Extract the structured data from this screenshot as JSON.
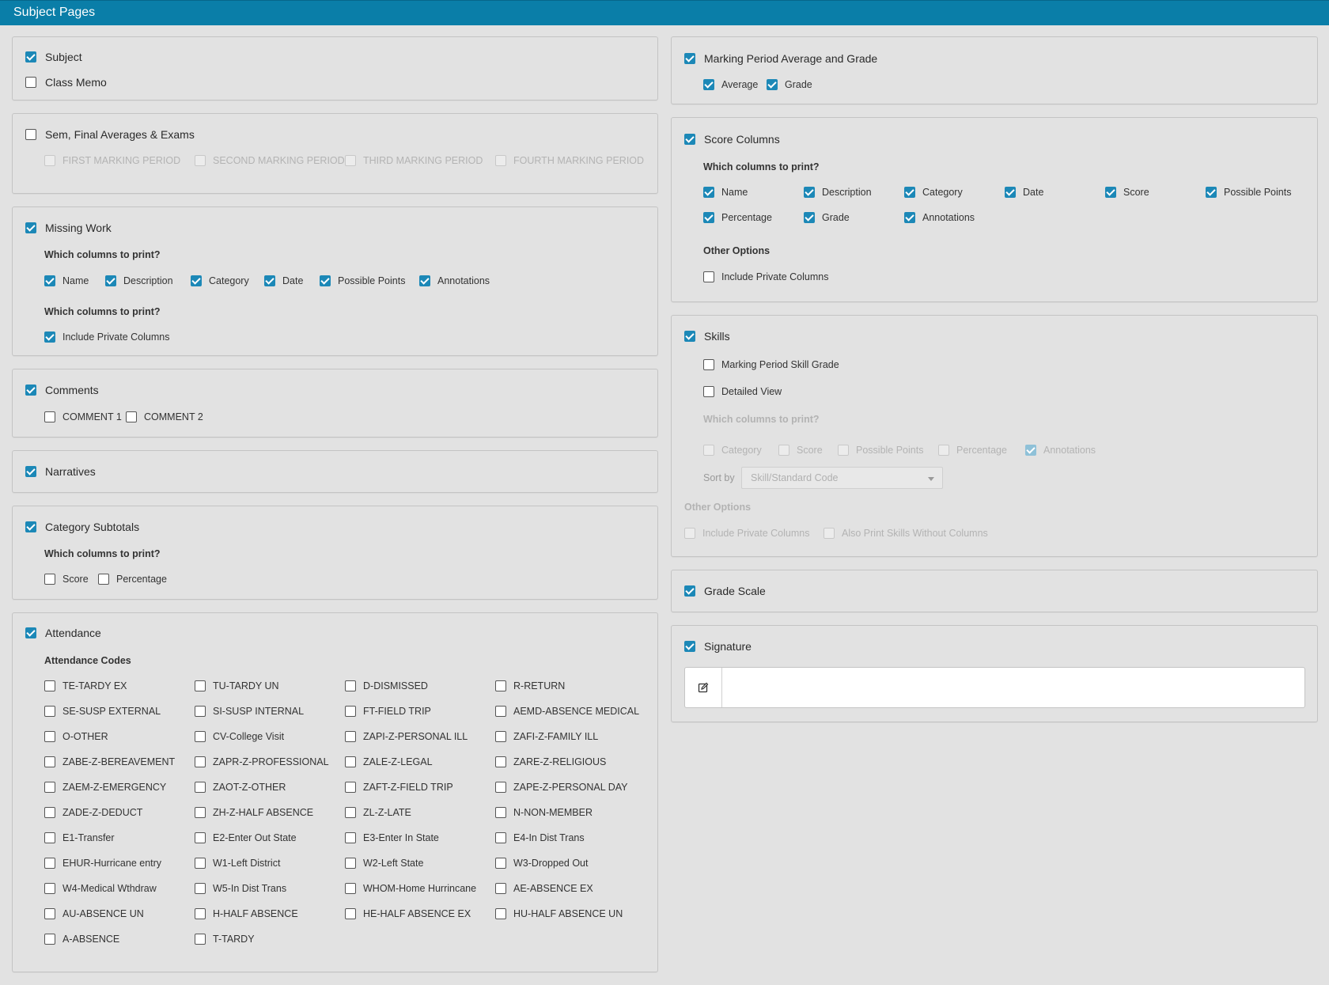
{
  "header": {
    "title": "Subject Pages"
  },
  "subject": {
    "subject_label": "Subject",
    "class_memo_label": "Class Memo"
  },
  "sem_final": {
    "label": "Sem, Final Averages & Exams",
    "periods": [
      "FIRST MARKING PERIOD",
      "SECOND MARKING PERIOD",
      "THIRD MARKING PERIOD",
      "FOURTH MARKING PERIOD"
    ]
  },
  "missing_work": {
    "label": "Missing Work",
    "columns_heading": "Which columns to print?",
    "columns": [
      "Name",
      "Description",
      "Category",
      "Date",
      "Possible Points",
      "Annotations"
    ],
    "options_heading": "Which columns to print?",
    "private_label": "Include Private Columns"
  },
  "comments": {
    "label": "Comments",
    "items": [
      "COMMENT 1",
      "COMMENT 2"
    ]
  },
  "narratives": {
    "label": "Narratives"
  },
  "category_subtotals": {
    "label": "Category Subtotals",
    "columns_heading": "Which columns to print?",
    "columns": [
      "Score",
      "Percentage"
    ]
  },
  "attendance": {
    "label": "Attendance",
    "codes_heading": "Attendance Codes",
    "codes": [
      [
        "TE-TARDY EX",
        "TU-TARDY UN",
        "D-DISMISSED",
        "R-RETURN"
      ],
      [
        "SE-SUSP EXTERNAL",
        "SI-SUSP INTERNAL",
        "FT-FIELD TRIP",
        "AEMD-ABSENCE MEDICAL"
      ],
      [
        "O-OTHER",
        "CV-College Visit",
        "ZAPI-Z-PERSONAL ILL",
        "ZAFI-Z-FAMILY ILL"
      ],
      [
        "ZABE-Z-BEREAVEMENT",
        "ZAPR-Z-PROFESSIONAL",
        "ZALE-Z-LEGAL",
        "ZARE-Z-RELIGIOUS"
      ],
      [
        "ZAEM-Z-EMERGENCY",
        "ZAOT-Z-OTHER",
        "ZAFT-Z-FIELD TRIP",
        "ZAPE-Z-PERSONAL DAY"
      ],
      [
        "ZADE-Z-DEDUCT",
        "ZH-Z-HALF ABSENCE",
        "ZL-Z-LATE",
        "N-NON-MEMBER"
      ],
      [
        "E1-Transfer",
        "E2-Enter Out State",
        "E3-Enter In State",
        "E4-In Dist Trans"
      ],
      [
        "EHUR-Hurricane entry",
        "W1-Left District",
        "W2-Left State",
        "W3-Dropped Out"
      ],
      [
        "W4-Medical Wthdraw",
        "W5-In Dist Trans",
        "WHOM-Home Hurrincane",
        "AE-ABSENCE EX"
      ],
      [
        "AU-ABSENCE UN",
        "H-HALF ABSENCE",
        "HE-HALF ABSENCE EX",
        "HU-HALF ABSENCE UN"
      ],
      [
        "A-ABSENCE",
        "T-TARDY"
      ]
    ]
  },
  "mp_avg": {
    "label": "Marking Period Average and Grade",
    "average_label": "Average",
    "grade_label": "Grade"
  },
  "score_columns": {
    "label": "Score Columns",
    "columns_heading": "Which columns to print?",
    "columns_row1": [
      "Name",
      "Description",
      "Category",
      "Date",
      "Score",
      "Possible Points"
    ],
    "columns_row2": [
      "Percentage",
      "Grade",
      "Annotations"
    ],
    "other_heading": "Other Options",
    "private_label": "Include Private Columns"
  },
  "skills": {
    "label": "Skills",
    "mp_skill_label": "Marking Period Skill Grade",
    "detailed_label": "Detailed View",
    "columns_heading": "Which columns to print?",
    "columns": [
      "Category",
      "Score",
      "Possible Points",
      "Percentage",
      "Annotations"
    ],
    "sort_label": "Sort by",
    "sort_value": "Skill/Standard Code",
    "other_heading": "Other Options",
    "private_label": "Include Private Columns",
    "also_print_label": "Also Print Skills Without Columns"
  },
  "grade_scale": {
    "label": "Grade Scale"
  },
  "signature": {
    "label": "Signature"
  },
  "colors": {
    "header": "#0a7ea8",
    "checkbox_checked": "#1c88b7",
    "background": "#e2e2e2"
  },
  "icons": {
    "edit": "edit-icon",
    "caret": "chevron-down-icon"
  }
}
